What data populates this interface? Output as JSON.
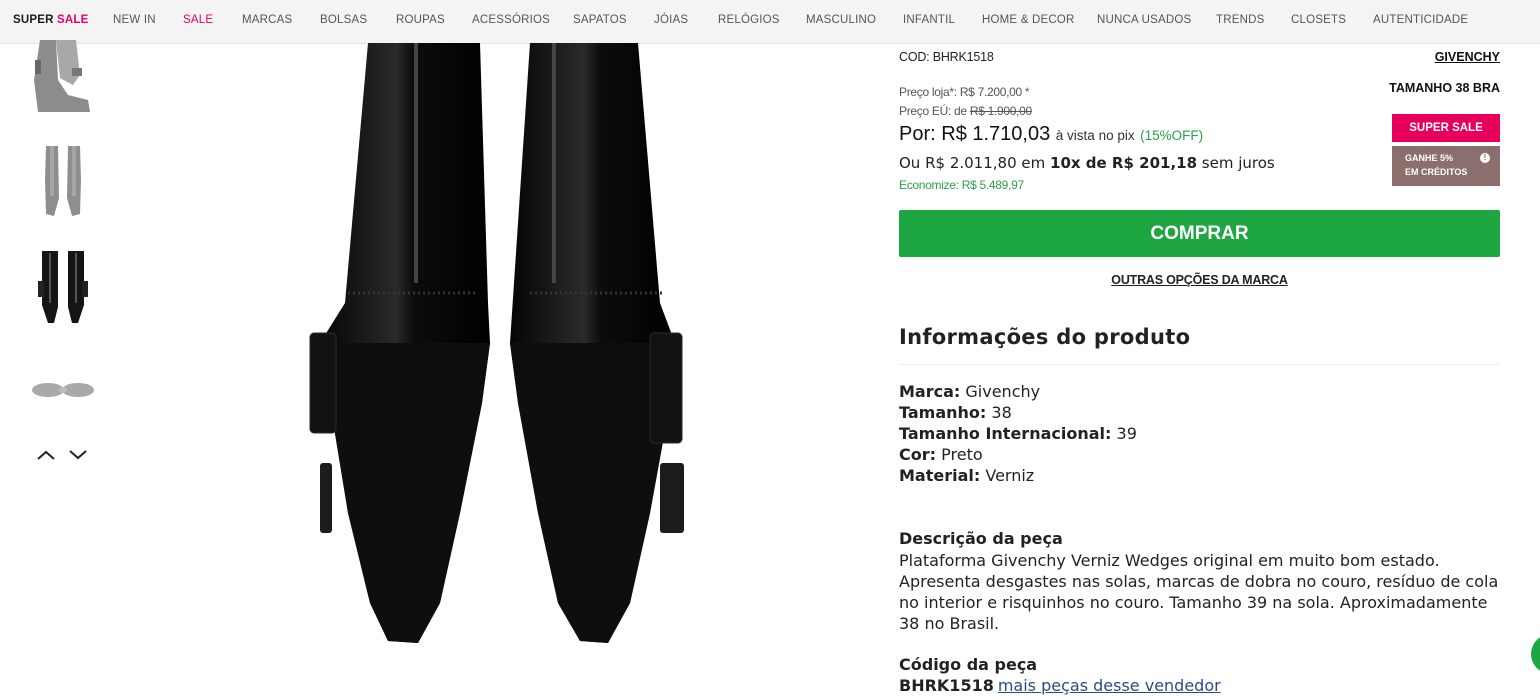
{
  "nav": {
    "items": [
      {
        "label_a": "SUPER ",
        "label_b": "SALE",
        "style": "supersale"
      },
      {
        "label": "NEW IN"
      },
      {
        "label": "SALE",
        "style": "pink"
      },
      {
        "label": "MARCAS"
      },
      {
        "label": "BOLSAS"
      },
      {
        "label": "ROUPAS"
      },
      {
        "label": "ACESSÓRIOS"
      },
      {
        "label": "SAPATOS"
      },
      {
        "label": "JÓIAS"
      },
      {
        "label": "RELÓGIOS"
      },
      {
        "label": "MASCULINO"
      },
      {
        "label": "INFANTIL"
      },
      {
        "label": "HOME & DECOR"
      },
      {
        "label": "NUNCA USADOS"
      },
      {
        "label": "TRENDS"
      },
      {
        "label": "CLOSETS"
      },
      {
        "label": "AUTENTICIDADE"
      }
    ]
  },
  "product": {
    "cod_label": "COD: BHRK1518",
    "brand_link": "GIVENCHY",
    "size_label": "TAMANHO 38 BRA",
    "badge_sale": "SUPER SALE",
    "badge_credit_l1": "GANHE 5%",
    "badge_credit_l2": "EM CRÉDITOS",
    "badge_credit_info": "!",
    "preco_loja_label": "Preço loja*:",
    "preco_loja_value": "R$ 7.200,00 *",
    "preco_eu_label": "Preço EÚ: de",
    "preco_eu_value": "R$ 1.900,00",
    "por_label": "Por:",
    "por_value": "R$ 1.710,03",
    "por_sub": "à vista no pix",
    "por_off": "(15%OFF)",
    "ou_label": "Ou R$ 2.011,80 em",
    "ou_installments": "10x de R$ 201,18",
    "ou_suffix": "sem juros",
    "economize": "Economize: R$ 5.489,97",
    "buy_label": "COMPRAR",
    "outras_label": "OUTRAS OPÇÕES DA MARCA"
  },
  "info": {
    "title": "Informações do produto",
    "specs": [
      {
        "k": "Marca:",
        "v": "Givenchy"
      },
      {
        "k": "Tamanho:",
        "v": "38"
      },
      {
        "k": "Tamanho Internacional:",
        "v": "39"
      },
      {
        "k": "Cor:",
        "v": "Preto"
      },
      {
        "k": "Material:",
        "v": "Verniz"
      }
    ],
    "desc_title": "Descrição da peça",
    "desc": "Plataforma Givenchy Verniz Wedges original em muito bom estado. Apresenta desgastes nas solas, marcas de dobra no couro, resíduo de cola no interior e risquinhos no couro. Tamanho 39 na sola. Aproximadamente 38 no Brasil.",
    "code_title": "Código da peça",
    "code_value": "BHRK1518",
    "code_link": "mais peças desse vendedor"
  },
  "colors": {
    "accent_pink": "#e6005c",
    "buy_green": "#1ea642",
    "credit_brown": "#8a6f6c"
  },
  "icons": {
    "prev": "chevron-left-icon",
    "next": "chevron-down-icon",
    "chat": "chat-icon"
  }
}
